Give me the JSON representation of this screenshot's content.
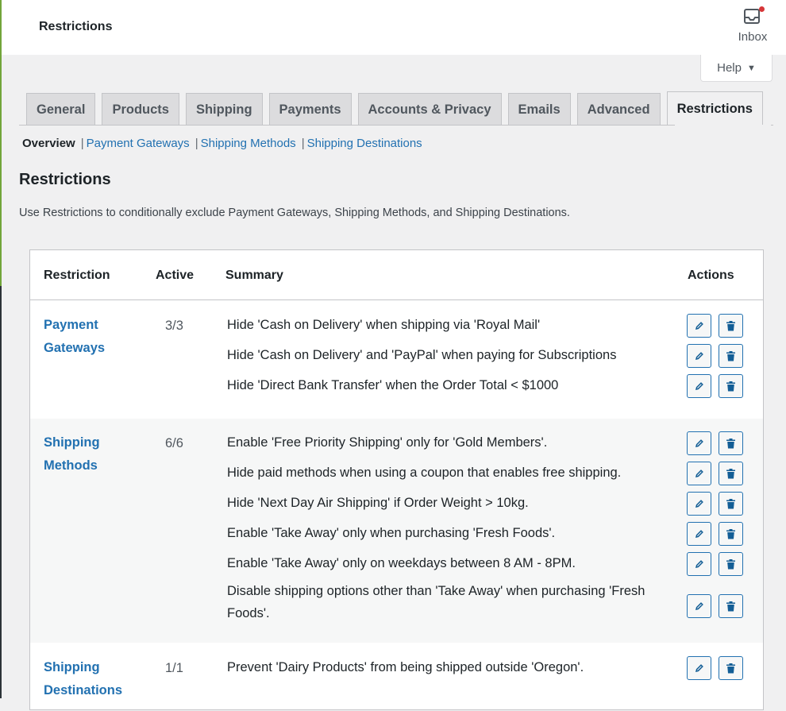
{
  "header": {
    "title": "Restrictions",
    "inbox_label": "Inbox"
  },
  "help": {
    "label": "Help"
  },
  "tabs": [
    {
      "label": "General",
      "active": false
    },
    {
      "label": "Products",
      "active": false
    },
    {
      "label": "Shipping",
      "active": false
    },
    {
      "label": "Payments",
      "active": false
    },
    {
      "label": "Accounts & Privacy",
      "active": false
    },
    {
      "label": "Emails",
      "active": false
    },
    {
      "label": "Advanced",
      "active": false
    },
    {
      "label": "Restrictions",
      "active": true
    }
  ],
  "subnav": {
    "current": "Overview",
    "links": [
      "Payment Gateways",
      "Shipping Methods",
      "Shipping Destinations"
    ],
    "separator": "|"
  },
  "page": {
    "heading": "Restrictions",
    "description": "Use Restrictions to conditionally exclude Payment Gateways, Shipping Methods, and Shipping Destinations."
  },
  "table": {
    "headers": {
      "restriction": "Restriction",
      "active": "Active",
      "summary": "Summary",
      "actions": "Actions"
    },
    "groups": [
      {
        "name": "Payment Gateways",
        "active": "3/3",
        "rules": [
          "Hide 'Cash on Delivery' when shipping via 'Royal Mail'",
          "Hide 'Cash on Delivery' and 'PayPal' when paying for Subscriptions",
          "Hide 'Direct Bank Transfer' when the Order Total < $1000"
        ]
      },
      {
        "name": "Shipping Methods",
        "active": "6/6",
        "rules": [
          "Enable 'Free Priority Shipping' only for 'Gold Members'.",
          "Hide paid methods when using a coupon that enables free shipping.",
          "Hide 'Next Day Air Shipping' if Order Weight > 10kg.",
          "Enable 'Take Away' only when purchasing 'Fresh Foods'.",
          "Enable 'Take Away' only on weekdays between 8 AM - 8PM.",
          "Disable shipping options other than 'Take Away' when purchasing 'Fresh Foods'."
        ]
      },
      {
        "name": "Shipping Destinations",
        "active": "1/1",
        "rules": [
          "Prevent 'Dairy Products' from being shipped outside 'Oregon'."
        ]
      }
    ]
  },
  "colors": {
    "link": "#2271b1",
    "background": "#f0f0f1",
    "notification": "#d63638"
  },
  "icons": {
    "inbox": "inbox-icon",
    "edit": "pencil-icon",
    "delete": "trash-icon",
    "dropdown": "caret-down-icon"
  }
}
